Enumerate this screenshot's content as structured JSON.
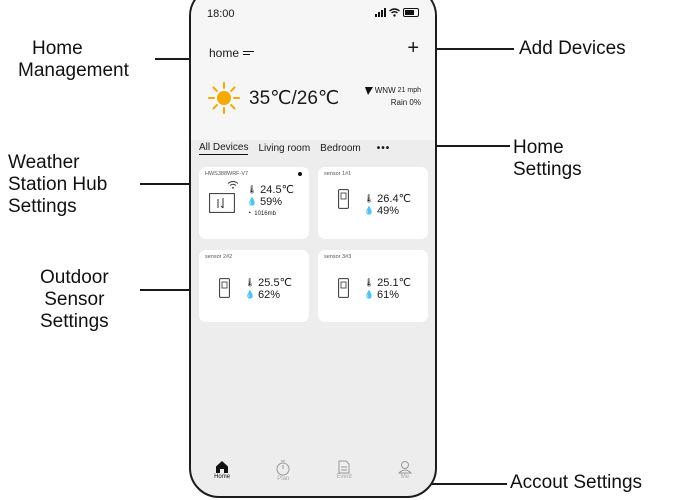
{
  "callouts": {
    "home_management": [
      "Home",
      "Management"
    ],
    "add_devices": "Add Devices",
    "home_settings": [
      "Home",
      "Settings"
    ],
    "weather_station": [
      "Weather",
      "Station Hub",
      "Settings"
    ],
    "outdoor_sensor": [
      "Outdoor",
      "Sensor",
      "Settings"
    ],
    "account_settings": "Accout Settings"
  },
  "status_bar": {
    "time": "18:00"
  },
  "header": {
    "home_name": "home",
    "add_symbol": "+"
  },
  "weather": {
    "temperature": "35℃/26℃",
    "wind": "WNW",
    "wind_speed": "21 mph",
    "rain": "Rain 0%"
  },
  "tabs": [
    "All Devices",
    "Living room",
    "Bedroom"
  ],
  "more_symbol": "•••",
  "devices": [
    {
      "name": "HWS388WRF-V7",
      "temp": "24.5℃",
      "humidity": "59%",
      "pressure": "1016mb"
    },
    {
      "name": "sensor 1#1",
      "temp": "26.4℃",
      "humidity": "49%"
    },
    {
      "name": "sensor 2#2",
      "temp": "25.5℃",
      "humidity": "62%"
    },
    {
      "name": "sensor 3#3",
      "temp": "25.1℃",
      "humidity": "61%"
    }
  ],
  "nav": [
    "Home",
    "Plan",
    "Event",
    "Me"
  ],
  "colors": {
    "sun": "#f5a800",
    "screen_bg": "#ededed",
    "card_bg": "#ffffff"
  }
}
